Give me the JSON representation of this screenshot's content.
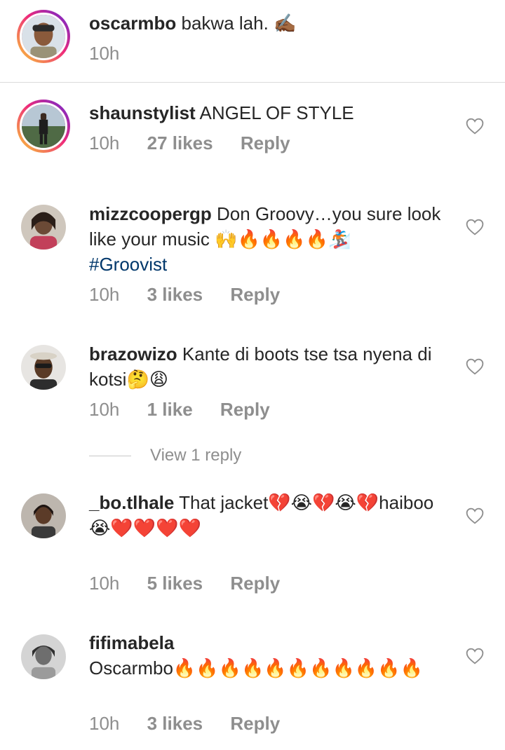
{
  "comments": [
    {
      "username": "oscarmbo",
      "text": "bakwa lah. ✍🏾",
      "time": "10h",
      "likes": "",
      "reply": ""
    },
    {
      "username": "shaunstylist",
      "text": "ANGEL OF STYLE",
      "time": "10h",
      "likes": "27 likes",
      "reply": "Reply"
    },
    {
      "username": "mizzcoopergp",
      "text": "Don Groovy…you sure look like your music 🙌🔥🔥🔥🔥🏂",
      "hashtag": "#Groovist",
      "time": "10h",
      "likes": "3 likes",
      "reply": "Reply"
    },
    {
      "username": "brazowizo",
      "text": "Kante di boots tse tsa nyena di kotsi🤔😩",
      "time": "10h",
      "likes": "1 like",
      "reply": "Reply"
    },
    {
      "username": "_bo.tlhale",
      "text": "That jacket💔😭💔😭💔haiboo😭❤️❤️❤️❤️",
      "time": "10h",
      "likes": "5 likes",
      "reply": "Reply"
    },
    {
      "username": "fifimabela",
      "text": "Oscarmbo🔥🔥🔥🔥🔥🔥🔥🔥🔥🔥🔥",
      "time": "10h",
      "likes": "3 likes",
      "reply": "Reply"
    }
  ],
  "view_replies_label": "View 1 reply",
  "colors": {
    "meta": "#8e8e8e",
    "hashtag": "#00376b",
    "divider": "#dbdbdb"
  },
  "icons": {
    "like": "heart-outline-icon"
  }
}
